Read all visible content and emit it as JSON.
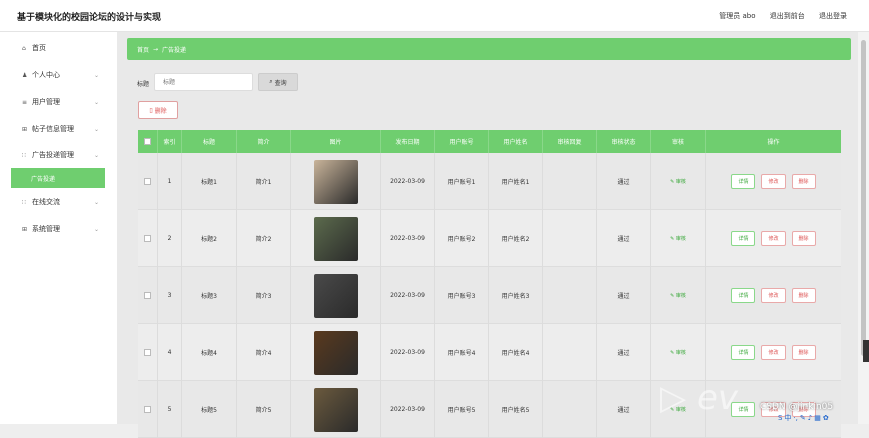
{
  "header": {
    "title": "基于模块化的校园论坛的设计与实现",
    "links": [
      "管理员 abo",
      "退出到前台",
      "退出登录"
    ]
  },
  "sidebar": {
    "items": [
      {
        "label": "首页",
        "icon": "home-icon",
        "glyph": "⌂",
        "chev": ""
      },
      {
        "label": "个人中心",
        "icon": "user-icon",
        "glyph": "♟",
        "chev": "⌄"
      },
      {
        "label": "用户管理",
        "icon": "list-icon",
        "glyph": "≡",
        "chev": "⌄"
      },
      {
        "label": "帖子信息管理",
        "icon": "grid-icon",
        "glyph": "⊞",
        "chev": "⌄"
      },
      {
        "label": "广告投递管理",
        "icon": "apps-icon",
        "glyph": "∷",
        "chev": "⌄"
      },
      {
        "label": "在线交流",
        "icon": "apps-icon",
        "glyph": "∷",
        "chev": "⌄"
      },
      {
        "label": "系统管理",
        "icon": "grid-icon",
        "glyph": "⊞",
        "chev": "⌄"
      }
    ],
    "active_sub": "广告投递"
  },
  "breadcrumb": {
    "home": "首页",
    "sep": "→",
    "current": "广告投递"
  },
  "search": {
    "label": "标题",
    "placeholder": "标题",
    "button": "查询",
    "button_icon": "search-icon"
  },
  "toolbar": {
    "delete_label": "删除",
    "delete_icon": "trash-icon"
  },
  "table": {
    "columns": [
      "",
      "索引",
      "标题",
      "简介",
      "图片",
      "发布日期",
      "用户账号",
      "用户姓名",
      "审核回复",
      "审核状态",
      "审核",
      "操作"
    ],
    "audit_label": "审核",
    "actions": [
      "详情",
      "修改",
      "删除"
    ],
    "rows": [
      {
        "index": "1",
        "title": "标题1",
        "intro": "简介1",
        "date": "2022-03-09",
        "account": "用户账号1",
        "name": "用户姓名1",
        "reply": "",
        "status": "通过",
        "thumb_color": "#c9b49a"
      },
      {
        "index": "2",
        "title": "标题2",
        "intro": "简介2",
        "date": "2022-03-09",
        "account": "用户账号2",
        "name": "用户姓名2",
        "reply": "",
        "status": "通过",
        "thumb_color": "#5c6b4d"
      },
      {
        "index": "3",
        "title": "标题3",
        "intro": "简介3",
        "date": "2022-03-09",
        "account": "用户账号3",
        "name": "用户姓名3",
        "reply": "",
        "status": "通过",
        "thumb_color": "#4a4a4a"
      },
      {
        "index": "4",
        "title": "标题4",
        "intro": "简介4",
        "date": "2022-03-09",
        "account": "用户账号4",
        "name": "用户姓名4",
        "reply": "",
        "status": "通过",
        "thumb_color": "#5a3a1e"
      },
      {
        "index": "5",
        "title": "标题5",
        "intro": "简介5",
        "date": "2022-03-09",
        "account": "用户账号5",
        "name": "用户姓名5",
        "reply": "",
        "status": "通过",
        "thumb_color": "#6b5a3e"
      }
    ]
  },
  "watermark": {
    "text": "CSDN @jinkin05"
  },
  "colors": {
    "accent": "#6fce6f",
    "danger": "#d55555"
  }
}
